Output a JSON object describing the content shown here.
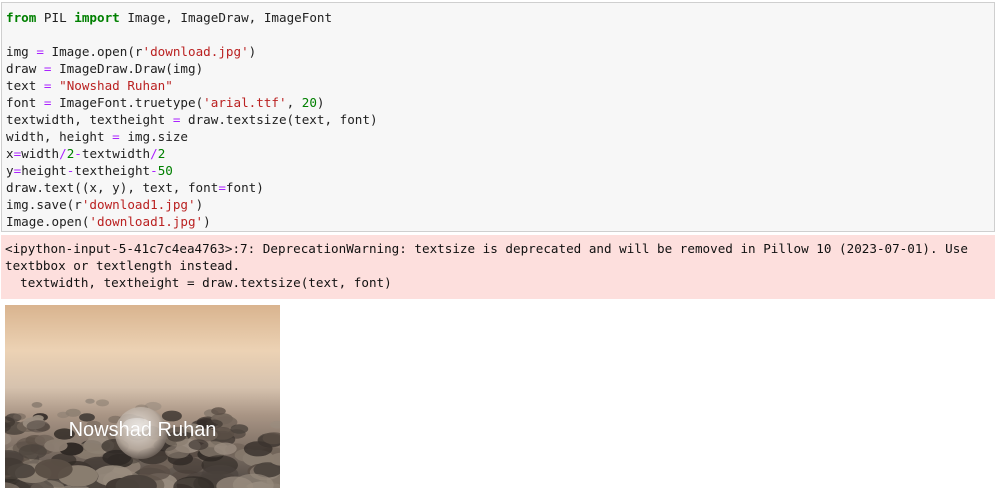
{
  "code_cell": {
    "lines": [
      [
        {
          "t": "from",
          "c": "kw"
        },
        {
          "t": " PIL ",
          "c": ""
        },
        {
          "t": "import",
          "c": "kw"
        },
        {
          "t": " Image, ImageDraw, ImageFont",
          "c": ""
        }
      ],
      [],
      [
        {
          "t": "img ",
          "c": ""
        },
        {
          "t": "=",
          "c": "op"
        },
        {
          "t": " Image.open(r",
          "c": ""
        },
        {
          "t": "'download.jpg'",
          "c": "str"
        },
        {
          "t": ")",
          "c": ""
        }
      ],
      [
        {
          "t": "draw ",
          "c": ""
        },
        {
          "t": "=",
          "c": "op"
        },
        {
          "t": " ImageDraw.Draw(img)",
          "c": ""
        }
      ],
      [
        {
          "t": "text ",
          "c": ""
        },
        {
          "t": "=",
          "c": "op"
        },
        {
          "t": " ",
          "c": ""
        },
        {
          "t": "\"Nowshad Ruhan\"",
          "c": "str"
        }
      ],
      [
        {
          "t": "font ",
          "c": ""
        },
        {
          "t": "=",
          "c": "op"
        },
        {
          "t": " ImageFont.truetype(",
          "c": ""
        },
        {
          "t": "'arial.ttf'",
          "c": "str"
        },
        {
          "t": ", ",
          "c": ""
        },
        {
          "t": "20",
          "c": "num"
        },
        {
          "t": ")",
          "c": ""
        }
      ],
      [
        {
          "t": "textwidth, textheight ",
          "c": ""
        },
        {
          "t": "=",
          "c": "op"
        },
        {
          "t": " draw.textsize(text, font)",
          "c": ""
        }
      ],
      [
        {
          "t": "width, height ",
          "c": ""
        },
        {
          "t": "=",
          "c": "op"
        },
        {
          "t": " img.size",
          "c": ""
        }
      ],
      [
        {
          "t": "x",
          "c": ""
        },
        {
          "t": "=",
          "c": "op"
        },
        {
          "t": "width",
          "c": ""
        },
        {
          "t": "/",
          "c": "op"
        },
        {
          "t": "2",
          "c": "num"
        },
        {
          "t": "-",
          "c": "op"
        },
        {
          "t": "textwidth",
          "c": ""
        },
        {
          "t": "/",
          "c": "op"
        },
        {
          "t": "2",
          "c": "num"
        }
      ],
      [
        {
          "t": "y",
          "c": ""
        },
        {
          "t": "=",
          "c": "op"
        },
        {
          "t": "height",
          "c": ""
        },
        {
          "t": "-",
          "c": "op"
        },
        {
          "t": "textheight",
          "c": ""
        },
        {
          "t": "-",
          "c": "op"
        },
        {
          "t": "50",
          "c": "num"
        }
      ],
      [
        {
          "t": "draw.text((x, y), text, font",
          "c": ""
        },
        {
          "t": "=",
          "c": "op"
        },
        {
          "t": "font)",
          "c": ""
        }
      ],
      [
        {
          "t": "img.save(r",
          "c": ""
        },
        {
          "t": "'download1.jpg'",
          "c": "str"
        },
        {
          "t": ")",
          "c": ""
        }
      ],
      [
        {
          "t": "Image.open(",
          "c": ""
        },
        {
          "t": "'download1.jpg'",
          "c": "str"
        },
        {
          "t": ")",
          "c": ""
        }
      ]
    ]
  },
  "stderr": {
    "lines": [
      "<ipython-input-5-41c7c4ea4763>:7: DeprecationWarning: textsize is deprecated and will be removed in Pillow 10 (2023-07-01). Use",
      "textbbox or textlength instead.",
      "  textwidth, textheight = draw.textsize(text, font)"
    ]
  },
  "output_image": {
    "caption": "Nowshad Ruhan",
    "sky_color": "#e9c9a6",
    "sea_color": "#bfa894",
    "stone_color": "#5c5048"
  }
}
